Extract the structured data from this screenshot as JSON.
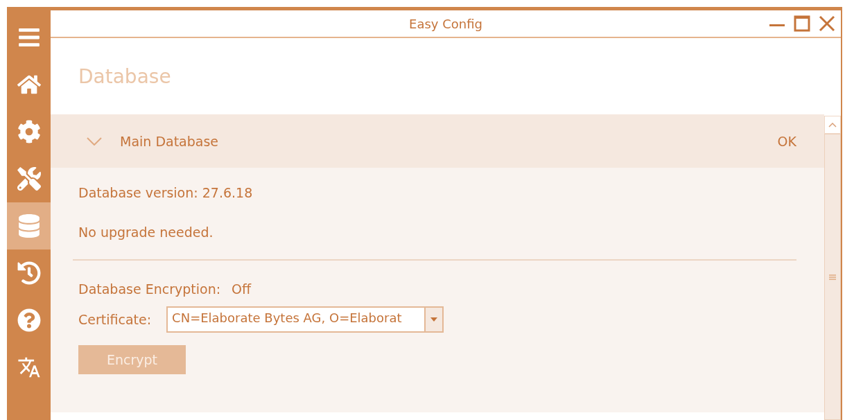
{
  "window": {
    "title": "Easy Config"
  },
  "sidebar": {
    "items": [
      {
        "kind": "menu",
        "selected": false
      },
      {
        "kind": "home",
        "selected": false
      },
      {
        "kind": "settings",
        "selected": false
      },
      {
        "kind": "tools",
        "selected": false
      },
      {
        "kind": "database",
        "selected": true
      },
      {
        "kind": "history",
        "selected": false
      },
      {
        "kind": "help",
        "selected": false
      },
      {
        "kind": "language",
        "selected": false
      }
    ]
  },
  "page_title": "Database",
  "section": {
    "title": "Main Database",
    "status": "OK",
    "expanded": true,
    "version": "Database version: 27.6.18",
    "upgrade": "No upgrade needed.",
    "encryption_label": "Database Encryption:",
    "encryption_value": "Off",
    "certificate_label": "Certificate:",
    "certificate_value": "CN=Elaborate Bytes AG, O=Elaborat",
    "encrypt_button": {
      "label": "Encrypt",
      "disabled": true
    }
  }
}
